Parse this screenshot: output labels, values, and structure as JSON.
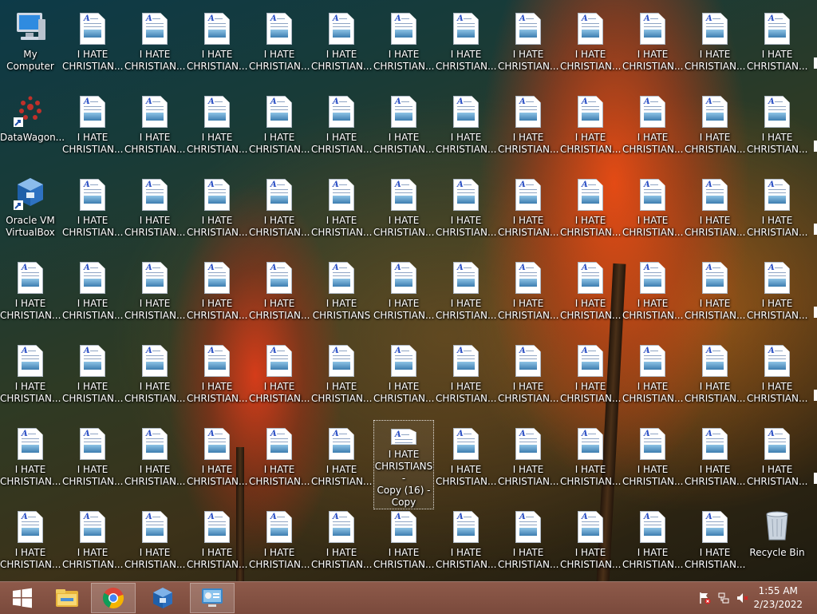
{
  "desktop": {
    "system_icons": [
      {
        "name": "my-computer-icon",
        "label": "My Computer",
        "kind": "computer"
      },
      {
        "name": "datawagon-icon",
        "label": "DataWagon...",
        "kind": "datawagon"
      },
      {
        "name": "virtualbox-icon",
        "label": "Oracle VM\nVirtualBox",
        "kind": "virtualbox"
      }
    ],
    "file_label_default": "I HATE\nCHRISTIAN...",
    "file_label_full": "I HATE\nCHRISTIANS",
    "selected_file_label": "I HATE\nCHRISTIANS -\nCopy (16) -\nCopy",
    "recycle_bin_label": "Recycle Bin",
    "file_icon": "document-image-icon"
  },
  "taskbar": {
    "start_icon": "windows-logo-icon",
    "apps": [
      {
        "name": "file-explorer-icon",
        "active": false
      },
      {
        "name": "chrome-icon",
        "active": true
      },
      {
        "name": "virtualbox-taskbar-icon",
        "active": false
      },
      {
        "name": "control-panel-icon",
        "active": true
      }
    ],
    "tray": {
      "flag_icon": "action-center-flag-icon",
      "network_icon": "network-icon",
      "volume_icon": "volume-muted-icon"
    },
    "clock": {
      "time": "1:55 AM",
      "date": "2/23/2022"
    }
  }
}
